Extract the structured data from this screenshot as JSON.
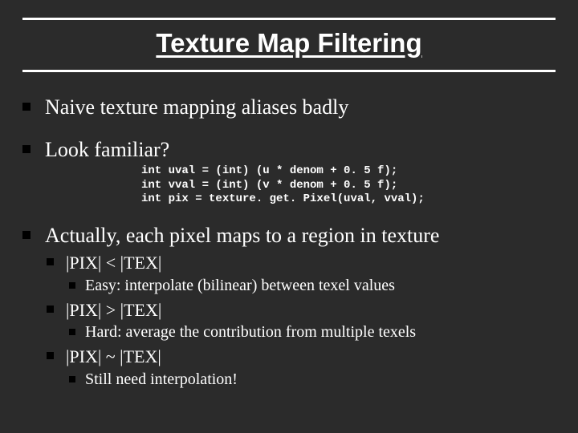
{
  "title": "Texture Map Filtering",
  "bullets": {
    "b1": "Naive texture mapping aliases badly",
    "b2": "Look familiar?",
    "code": "int uval = (int) (u * denom + 0. 5 f);\nint vval = (int) (v * denom + 0. 5 f);\nint pix = texture. get. Pixel(uval, vval);",
    "b3": "Actually, each pixel maps to a region in texture",
    "s1": "|PIX| < |TEX|",
    "s1a": "Easy: interpolate (bilinear) between texel values",
    "s2": "|PIX| > |TEX|",
    "s2a": "Hard: average the contribution from multiple texels",
    "s3": "|PIX| ~ |TEX|",
    "s3a": "Still need interpolation!"
  }
}
